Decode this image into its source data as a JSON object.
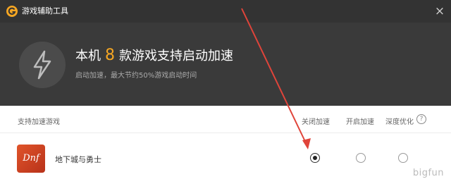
{
  "window": {
    "title": "游戏辅助工具",
    "close_glyph": "×"
  },
  "hero": {
    "headline_prefix": "本机",
    "count": "8",
    "headline_suffix": "款游戏支持启动加速",
    "subline": "启动加速，最大节约50%游戏启动时间",
    "icon": "lightning-icon"
  },
  "table": {
    "headers": {
      "game": "支持加速游戏",
      "off": "关闭加速",
      "on": "开启加速",
      "deep": "深度优化",
      "help_glyph": "?"
    },
    "rows": [
      {
        "name": "地下城与勇士",
        "icon_text": "Dnf",
        "selected": "off"
      }
    ]
  },
  "watermark": "bigfun",
  "colors": {
    "titlebar": "#333333",
    "hero_bg": "#3a3a3a",
    "accent": "#f5a623",
    "arrow": "#e0443a"
  }
}
